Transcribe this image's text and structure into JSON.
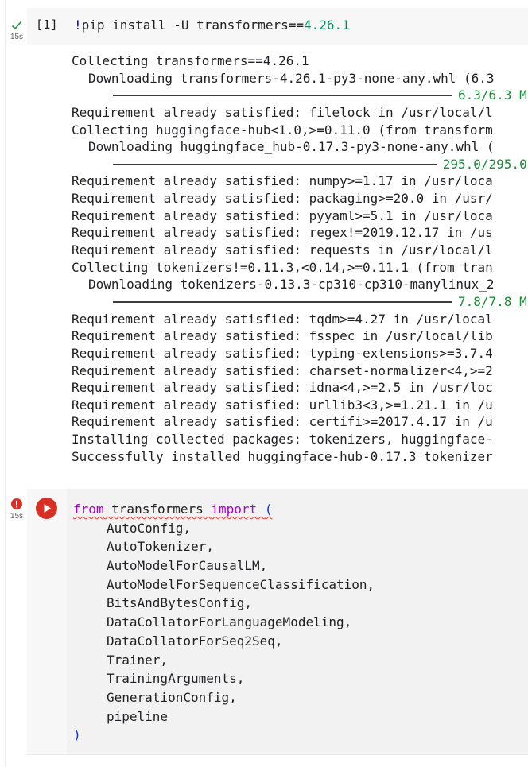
{
  "cell1": {
    "exec_time": "15s",
    "exec_count": "[1]",
    "code": {
      "bang": "!",
      "text": "pip install -U transformers==",
      "version": "4.26.1"
    },
    "output": [
      {
        "kind": "text",
        "indent": false,
        "text": "Collecting transformers==4.26.1"
      },
      {
        "kind": "text",
        "indent": true,
        "text": "Downloading transformers-4.26.1-py3-none-any.whl (6.3"
      },
      {
        "kind": "bar",
        "label": "6.3/6.3 M",
        "progress": 1.0
      },
      {
        "kind": "text",
        "indent": false,
        "text": "Requirement already satisfied: filelock in /usr/local/l"
      },
      {
        "kind": "text",
        "indent": false,
        "text": "Collecting huggingface-hub<1.0,>=0.11.0 (from transform"
      },
      {
        "kind": "text",
        "indent": true,
        "text": "Downloading huggingface_hub-0.17.3-py3-none-any.whl ("
      },
      {
        "kind": "bar",
        "label": "295.0/295.0",
        "progress": 1.0
      },
      {
        "kind": "text",
        "indent": false,
        "text": "Requirement already satisfied: numpy>=1.17 in /usr/loca"
      },
      {
        "kind": "text",
        "indent": false,
        "text": "Requirement already satisfied: packaging>=20.0 in /usr/"
      },
      {
        "kind": "text",
        "indent": false,
        "text": "Requirement already satisfied: pyyaml>=5.1 in /usr/loca"
      },
      {
        "kind": "text",
        "indent": false,
        "text": "Requirement already satisfied: regex!=2019.12.17 in /us"
      },
      {
        "kind": "text",
        "indent": false,
        "text": "Requirement already satisfied: requests in /usr/local/l"
      },
      {
        "kind": "text",
        "indent": false,
        "text": "Collecting tokenizers!=0.11.3,<0.14,>=0.11.1 (from tran"
      },
      {
        "kind": "text",
        "indent": true,
        "text": "Downloading tokenizers-0.13.3-cp310-cp310-manylinux_2"
      },
      {
        "kind": "bar",
        "label": "7.8/7.8 M",
        "progress": 1.0
      },
      {
        "kind": "text",
        "indent": false,
        "text": "Requirement already satisfied: tqdm>=4.27 in /usr/local"
      },
      {
        "kind": "text",
        "indent": false,
        "text": "Requirement already satisfied: fsspec in /usr/local/lib"
      },
      {
        "kind": "text",
        "indent": false,
        "text": "Requirement already satisfied: typing-extensions>=3.7.4"
      },
      {
        "kind": "text",
        "indent": false,
        "text": "Requirement already satisfied: charset-normalizer<4,>=2"
      },
      {
        "kind": "text",
        "indent": false,
        "text": "Requirement already satisfied: idna<4,>=2.5 in /usr/loc"
      },
      {
        "kind": "text",
        "indent": false,
        "text": "Requirement already satisfied: urllib3<3,>=1.21.1 in /u"
      },
      {
        "kind": "text",
        "indent": false,
        "text": "Requirement already satisfied: certifi>=2017.4.17 in /u"
      },
      {
        "kind": "text",
        "indent": false,
        "text": "Installing collected packages: tokenizers, huggingface-"
      },
      {
        "kind": "text",
        "indent": false,
        "text": "Successfully installed huggingface-hub-0.17.3 tokenizer"
      }
    ]
  },
  "cell2": {
    "exec_time": "15s",
    "code_lines": [
      {
        "tokens": [
          {
            "t": "from",
            "c": "kw-from squiggle"
          },
          {
            "t": " transformers ",
            "c": "squiggle"
          },
          {
            "t": "import",
            "c": "kw-import squiggle"
          },
          {
            "t": " ",
            "c": "squiggle"
          },
          {
            "t": "(",
            "c": "paren squiggle"
          }
        ],
        "indent": false
      },
      {
        "tokens": [
          {
            "t": "AutoConfig,",
            "c": ""
          }
        ],
        "indent": true
      },
      {
        "tokens": [
          {
            "t": "AutoTokenizer,",
            "c": ""
          }
        ],
        "indent": true
      },
      {
        "tokens": [
          {
            "t": "AutoModelForCausalLM,",
            "c": ""
          }
        ],
        "indent": true
      },
      {
        "tokens": [
          {
            "t": "AutoModelForSequenceClassification,",
            "c": ""
          }
        ],
        "indent": true
      },
      {
        "tokens": [
          {
            "t": "BitsAndBytesConfig,",
            "c": ""
          }
        ],
        "indent": true
      },
      {
        "tokens": [
          {
            "t": "DataCollatorForLanguageModeling,",
            "c": ""
          }
        ],
        "indent": true
      },
      {
        "tokens": [
          {
            "t": "DataCollatorForSeq2Seq,",
            "c": ""
          }
        ],
        "indent": true
      },
      {
        "tokens": [
          {
            "t": "Trainer,",
            "c": ""
          }
        ],
        "indent": true
      },
      {
        "tokens": [
          {
            "t": "TrainingArguments,",
            "c": ""
          }
        ],
        "indent": true
      },
      {
        "tokens": [
          {
            "t": "GenerationConfig,",
            "c": ""
          }
        ],
        "indent": true
      },
      {
        "tokens": [
          {
            "t": "pipeline",
            "c": ""
          }
        ],
        "indent": true
      },
      {
        "tokens": [
          {
            "t": ")",
            "c": "paren"
          }
        ],
        "indent": false
      }
    ]
  },
  "icons": {
    "cell1_status": "check-icon",
    "cell2_status": "error-icon",
    "run": "play-icon"
  },
  "colors": {
    "success": "#1e8e3e",
    "error": "#d93025",
    "progress_text": "#1e8c3a",
    "keyword": "#af00db",
    "paren": "#0431fa",
    "version": "#098658"
  }
}
